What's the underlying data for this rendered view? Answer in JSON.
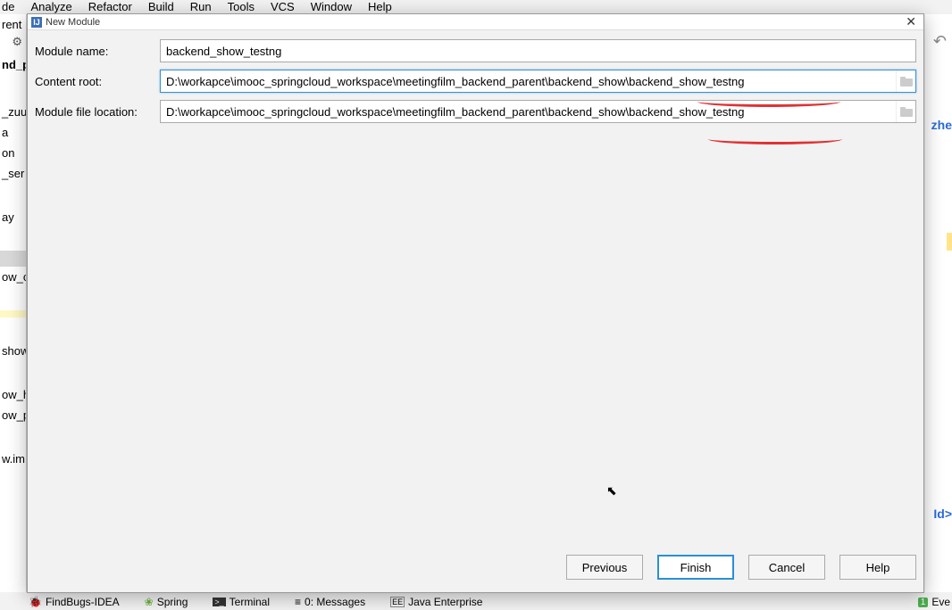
{
  "menu": [
    "de",
    "Analyze",
    "Refactor",
    "Build",
    "Run",
    "Tools",
    "VCS",
    "Window",
    "Help"
  ],
  "sidebar": {
    "items": [
      "rent",
      "nd_p",
      "_zuu",
      "a",
      "on",
      "_ser",
      "ay",
      "ow_c",
      "show",
      "ow_h",
      "ow_p",
      "w.im"
    ]
  },
  "right": {
    "zhe": "zhe",
    "idgt": "Id>"
  },
  "bottombar": {
    "findbugs": "FindBugs-IDEA",
    "spring": "Spring",
    "terminal": "Terminal",
    "messages": "0: Messages",
    "javaee": "Java Enterprise",
    "event_count": "1",
    "event_label": "Eve"
  },
  "dialog": {
    "title": "New Module",
    "labels": {
      "module_name": "Module name:",
      "content_root": "Content root:",
      "module_file_location": "Module file location:"
    },
    "values": {
      "module_name": "backend_show_testng",
      "content_root": "D:\\workapce\\imooc_springcloud_workspace\\meetingfilm_backend_parent\\backend_show\\backend_show_testng",
      "module_file_location": "D:\\workapce\\imooc_springcloud_workspace\\meetingfilm_backend_parent\\backend_show\\backend_show_testng"
    },
    "buttons": {
      "previous": "Previous",
      "finish": "Finish",
      "cancel": "Cancel",
      "help": "Help"
    }
  }
}
